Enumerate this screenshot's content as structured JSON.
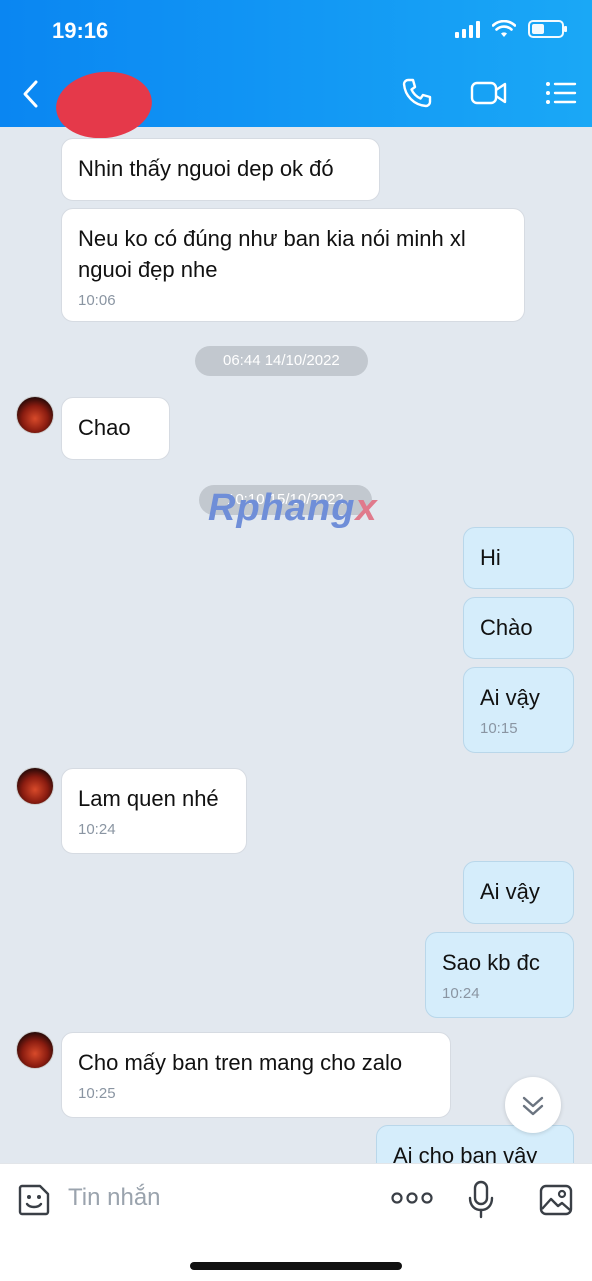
{
  "status_bar": {
    "time": "19:16"
  },
  "header": {
    "contact_name": ""
  },
  "messages": [
    {
      "dir": "in",
      "text": "Nhin thấy nguoi dep ok đó"
    },
    {
      "dir": "in",
      "text": "Neu ko có đúng như ban kia nói minh xl nguoi đẹp nhe",
      "time": "10:06"
    },
    {
      "date": "06:44 14/10/2022"
    },
    {
      "dir": "in",
      "text": "Chao"
    },
    {
      "date": "10:10 15/10/2022"
    },
    {
      "dir": "out",
      "text": "Hi"
    },
    {
      "dir": "out",
      "text": "Chào"
    },
    {
      "dir": "out",
      "text": "Ai vậy",
      "time": "10:15"
    },
    {
      "dir": "in",
      "text": "Lam quen nhé",
      "time": "10:24"
    },
    {
      "dir": "out",
      "text": "Ai vậy"
    },
    {
      "dir": "out",
      "text": "Sao kb đc",
      "time": "10:24"
    },
    {
      "dir": "in",
      "text": "Cho mấy ban tren mang cho zalo",
      "time": "10:25"
    },
    {
      "dir": "out",
      "text": "Ai cho ban vậy"
    }
  ],
  "watermark": {
    "main": "Rphang",
    "suffix": "x"
  },
  "composer": {
    "placeholder": "Tin nhắn"
  },
  "icons": {
    "back": "chevron-left-icon",
    "call": "phone-icon",
    "video": "video-camera-icon",
    "menu": "list-menu-icon",
    "scroll": "double-chevron-down-icon",
    "sticker": "sticker-face-icon",
    "more": "more-dots-icon",
    "mic": "microphone-icon",
    "image": "image-icon"
  },
  "colors": {
    "header": "#0a86f2",
    "incoming": "#ffffff",
    "outgoing": "#d5edfb",
    "background": "#e2e8ef"
  }
}
